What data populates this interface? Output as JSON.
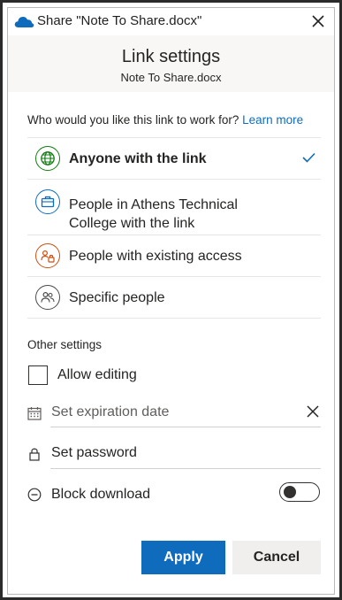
{
  "window": {
    "title": "Share \"Note To Share.docx\"",
    "cloud_icon": "onedrive-cloud-icon",
    "close_icon": "close-icon"
  },
  "header": {
    "title": "Link settings",
    "file_name": "Note To Share.docx"
  },
  "audience": {
    "question": "Who would you like this link to work for?",
    "learn_more": "Learn more",
    "options": [
      {
        "label": "Anyone with the link",
        "icon": "globe-icon",
        "selected": true
      },
      {
        "label_line1": "People in Athens Technical",
        "label_line2": "College with the link",
        "icon": "organization-icon",
        "selected": false
      },
      {
        "label": "People with existing access",
        "icon": "people-lock-icon",
        "selected": false
      },
      {
        "label": "Specific people",
        "icon": "people-icon",
        "selected": false
      }
    ]
  },
  "other_settings": {
    "title": "Other settings",
    "allow_editing": {
      "label": "Allow editing",
      "checked": false
    },
    "expiration": {
      "placeholder": "Set expiration date",
      "icon": "calendar-icon"
    },
    "password": {
      "label": "Set password",
      "icon": "lock-icon"
    },
    "block_download": {
      "label": "Block download",
      "icon": "block-icon",
      "enabled": false
    }
  },
  "buttons": {
    "apply": "Apply",
    "cancel": "Cancel"
  },
  "colors": {
    "accent": "#0f6cbd",
    "globe": "#107c10",
    "organization": "#0f6cbd",
    "existing_access": "#ca5010",
    "specific_people": "#4a4a4a",
    "header_bg": "#f8f7f6"
  }
}
